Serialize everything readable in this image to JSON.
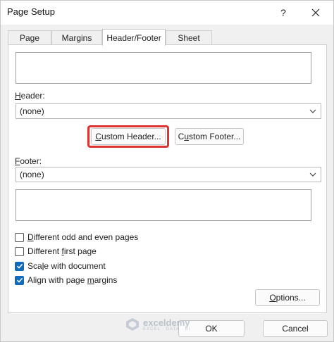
{
  "window": {
    "title": "Page Setup",
    "help": "?"
  },
  "tabs": [
    {
      "label": "Page"
    },
    {
      "label": "Margins"
    },
    {
      "label": "Header/Footer"
    },
    {
      "label": "Sheet"
    }
  ],
  "header": {
    "label_accel": "H",
    "label_rest": "eader:",
    "selected": "(none)"
  },
  "buttons": {
    "custom_header_accel": "C",
    "custom_header_rest": "ustom Header...",
    "custom_footer_pre": "C",
    "custom_footer_accel": "u",
    "custom_footer_rest": "stom Footer...",
    "options_accel": "O",
    "options_rest": "ptions...",
    "ok": "OK",
    "cancel": "Cancel"
  },
  "footer": {
    "label_accel": "F",
    "label_rest": "ooter:",
    "selected": "(none)"
  },
  "checkboxes": [
    {
      "accel": "D",
      "rest": "ifferent odd and even pages",
      "checked": false
    },
    {
      "accel": "",
      "pre": "Different ",
      "accel2": "f",
      "rest": "irst page",
      "checked": false
    },
    {
      "pre": "Sca",
      "accel": "l",
      "rest": "e with document",
      "checked": true
    },
    {
      "pre": "Align with page ",
      "accel": "m",
      "rest": "argins",
      "checked": true
    }
  ],
  "watermark": {
    "name": "exceldemy",
    "tagline": "EXCEL · DATA · BI"
  },
  "colors": {
    "highlight": "#e0332f",
    "accent": "#0f6cbd"
  }
}
